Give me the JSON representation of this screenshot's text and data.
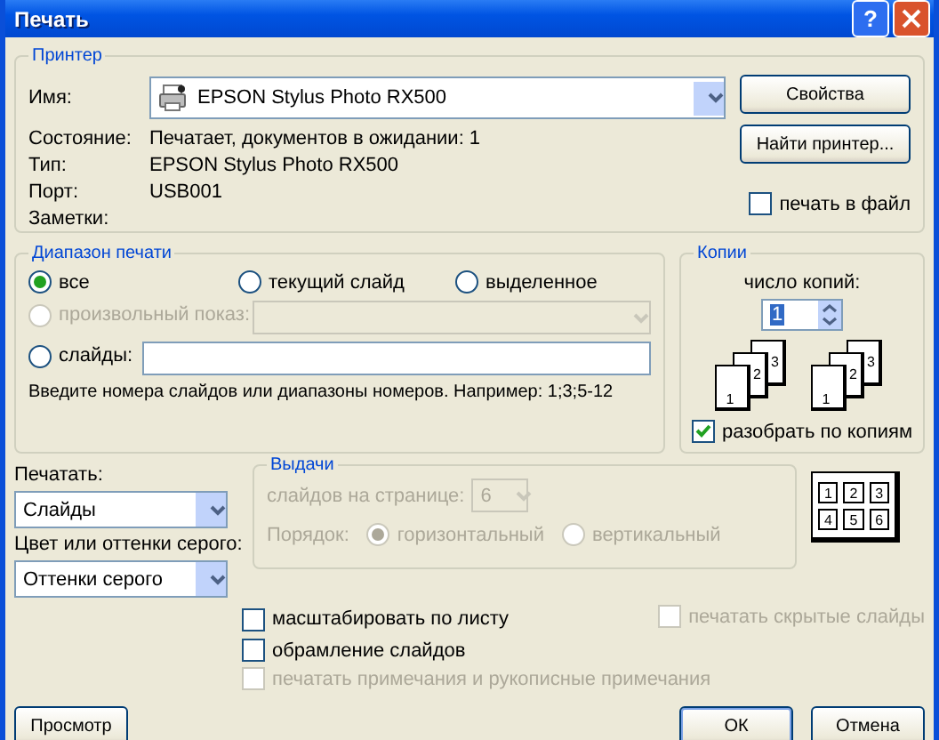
{
  "window": {
    "title": "Печать",
    "help": "?"
  },
  "printer": {
    "legend": "Принтер",
    "name_label": "Имя:",
    "name_value": "EPSON Stylus Photo RX500",
    "details": [
      {
        "label": "Состояние:",
        "value": "Печатает, документов в ожидании: 1"
      },
      {
        "label": "Тип:",
        "value": "EPSON Stylus Photo RX500"
      },
      {
        "label": "Порт:",
        "value": "USB001"
      },
      {
        "label": "Заметки:"
      }
    ],
    "buttons": [
      "Свойства",
      "Найти принтер..."
    ],
    "print_to_file": {
      "label": "печать в файл",
      "checked": false
    }
  },
  "range": {
    "legend": "Диапазон печати",
    "options": [
      {
        "label": "все",
        "selected": true
      },
      {
        "label": "текущий слайд",
        "selected": false
      },
      {
        "label": "выделенное",
        "selected": false
      }
    ],
    "custom_show": {
      "label": "произвольный показ:",
      "selected": false,
      "disabled": true
    },
    "slides": {
      "label": "слайды:",
      "selected": false
    },
    "hint": "Введите номера слайдов или диапазоны номеров. Например: 1;3;5-12"
  },
  "copies": {
    "legend": "Копии",
    "count_label": "число копий:",
    "count": "1",
    "collated_pages": [
      "1",
      "2",
      "3"
    ],
    "uncollated_pages": [
      "1",
      "2",
      "3"
    ],
    "collate": {
      "label": "разобрать по копиям",
      "checked": true
    }
  },
  "print_what": {
    "label": "Печатать:",
    "value": "Слайды"
  },
  "color": {
    "label": "Цвет или оттенки серого:",
    "value": "Оттенки серого"
  },
  "handouts": {
    "legend": "Выдачи",
    "disabled": true,
    "per_page_label": "слайдов на странице:",
    "per_page": "6",
    "order_label": "Порядок:",
    "orders": [
      {
        "label": "горизонтальный",
        "selected": true
      },
      {
        "label": "вертикальный",
        "selected": false
      }
    ],
    "preview": [
      "1",
      "2",
      "3",
      "4",
      "5",
      "6"
    ]
  },
  "options": [
    {
      "label": "масштабировать по листу",
      "checked": false,
      "disabled": false
    },
    {
      "label": "печатать скрытые слайды",
      "checked": false,
      "disabled": true
    },
    {
      "label": "обрамление слайдов",
      "checked": false,
      "disabled": false
    },
    {
      "label": "печатать примечания и рукописные примечания",
      "checked": false,
      "disabled": true
    }
  ],
  "buttons": {
    "preview": "Просмотр",
    "ok": "ОК",
    "cancel": "Отмена"
  }
}
